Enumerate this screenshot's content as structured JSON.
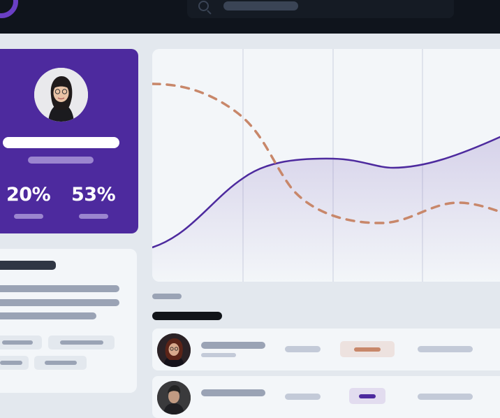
{
  "profile": {
    "stats": [
      {
        "value": "20%"
      },
      {
        "value": "53%"
      }
    ]
  },
  "chart_data": {
    "type": "line",
    "series": [
      {
        "style": "solid",
        "color": "#4d2a9e",
        "fill": "gradient"
      },
      {
        "style": "dashed",
        "color": "#c8876a"
      }
    ]
  },
  "colors": {
    "accent": "#4d2a9e",
    "dashed_line": "#c8876a",
    "topbar": "#0f141c",
    "page_bg": "#e3e8ee",
    "card_bg": "#f3f6f9"
  },
  "icons": [
    "search-icon",
    "logo-icon",
    "user-avatar",
    "list-avatar"
  ]
}
